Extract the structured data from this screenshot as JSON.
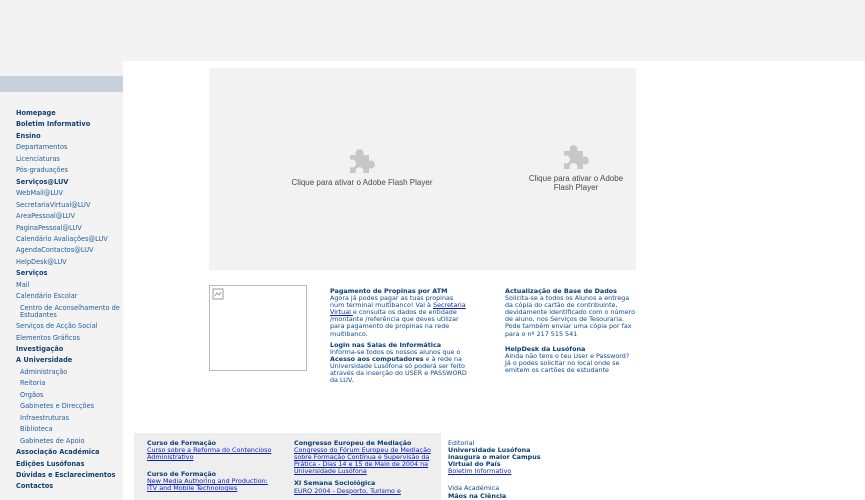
{
  "nav": [
    {
      "label": "Homepage",
      "bold": true,
      "indent": false
    },
    {
      "label": "Boletim Informativo",
      "bold": true,
      "indent": false
    },
    {
      "label": "Ensino",
      "bold": true,
      "indent": false
    },
    {
      "label": "Departamentos",
      "bold": false,
      "indent": false
    },
    {
      "label": "Licenciaturas",
      "bold": false,
      "indent": false
    },
    {
      "label": "Pós-graduações",
      "bold": false,
      "indent": false
    },
    {
      "label": "Serviços@LUV",
      "bold": true,
      "indent": false
    },
    {
      "label": "WebMail@LUV",
      "bold": false,
      "indent": false
    },
    {
      "label": "SecretariaVirtual@LUV",
      "bold": false,
      "indent": false
    },
    {
      "label": "AreaPessoal@LUV",
      "bold": false,
      "indent": false
    },
    {
      "label": "PaginaPessoal@LUV",
      "bold": false,
      "indent": false
    },
    {
      "label": "Calendário Avaliações@LUV",
      "bold": false,
      "indent": false
    },
    {
      "label": "AgendaContactos@LUV",
      "bold": false,
      "indent": false
    },
    {
      "label": "HelpDesk@LUV",
      "bold": false,
      "indent": false
    },
    {
      "label": "Serviços",
      "bold": true,
      "indent": false
    },
    {
      "label": "Mail",
      "bold": false,
      "indent": false
    },
    {
      "label": "Calendário Escolar",
      "bold": false,
      "indent": false
    },
    {
      "label": "Centro de Aconselhamento de Estudantes",
      "bold": false,
      "indent": true,
      "multiline": true
    },
    {
      "label": "Serviços de Acção Social",
      "bold": false,
      "indent": false
    },
    {
      "label": "Elementos Gráficos",
      "bold": false,
      "indent": false
    },
    {
      "label": "Investigação",
      "bold": true,
      "indent": false
    },
    {
      "label": "A Universidade",
      "bold": true,
      "indent": false
    },
    {
      "label": "Administração",
      "bold": false,
      "indent": true
    },
    {
      "label": "Reitoria",
      "bold": false,
      "indent": true
    },
    {
      "label": "Orgãos",
      "bold": false,
      "indent": true
    },
    {
      "label": "Gabinetes e Direcções",
      "bold": false,
      "indent": true
    },
    {
      "label": "Infraestruturas",
      "bold": false,
      "indent": true
    },
    {
      "label": "Biblioteca",
      "bold": false,
      "indent": true
    },
    {
      "label": "Gabinetes de Apoio",
      "bold": false,
      "indent": true
    },
    {
      "label": "Associação Académica",
      "bold": true,
      "indent": false
    },
    {
      "label": "Edições Lusófonas",
      "bold": true,
      "indent": false
    },
    {
      "label": "Dúvidas e Esclarecimentos",
      "bold": true,
      "indent": false
    },
    {
      "label": "Contactos",
      "bold": true,
      "indent": false
    }
  ],
  "flash": {
    "left_text": "Clique para ativar o Adobe Flash Player",
    "right_line1": "Clique para ativar o Adobe",
    "right_line2": "Flash Player",
    "icon": "puzzle-piece-icon"
  },
  "news_left": {
    "propinas_title": "Pagamento de Propinas por ATM",
    "propinas_pre": "Agora já podes pagar as tuas propinas num terminal multibanco! Vai à ",
    "propinas_link": "Secretaria Virtual ",
    "propinas_post": "e consulta os dados de entidade /montante /referência que deves utilizar para pagamento de propinas na rede multibanco.",
    "login_title": "Login nas Salas de Informática",
    "login_pre": "Informa-se todos os nossos alunos que o ",
    "login_bold": "Acesso aos computadores",
    "login_post": " e à rede na Universidade Lusófona só poderá ser feito através da inserção do USER e PASSWORD da LUV."
  },
  "news_right": {
    "atualizacao_title": "Actualização de Base de Dados",
    "atualizacao_text": "Solicita-se a todos os Alunos a entrega da cópia do cartão de contribuinte, devidamente identificado com o número de aluno, nos Serviços de Tesouraria. Pode também enviar uma cópia por fax para o nº 217 515 541",
    "helpdesk_title": "HelpDesk da Lusófona",
    "helpdesk_text": "Ainda não tens o teu User e Password? Já o podes solicitar no local onde se emitem os cartões de estudante"
  },
  "bottom_left": {
    "h1": "Curso de Formação",
    "l1": "Curso sobre a Reforma do Contencioso Administrativo",
    "h2": "Curso de Formação",
    "l2": "New Media Authoring and Production: ITV and Mobile Technologies"
  },
  "bottom_mid": {
    "h1": "Congresso Europeu de Mediação",
    "l1": "Congresso do Fórum Europeu de Mediação sobre Formação Contínua e Supervisão da Prática - Dias 14 e 15 de Maio de 2004 na Universidade Lusófona",
    "h2": "XI Semana Sociológica",
    "l2": "EURO 2004 - Desporto, Turismo e"
  },
  "bottom_right": {
    "editorial": "Editorial",
    "headline": "Universidade Lusófona inaugura o maior Campus Virtual do País",
    "link": "Boletim Informativo",
    "section": "Vida Académica",
    "section_title": "Mãos na Ciência"
  }
}
